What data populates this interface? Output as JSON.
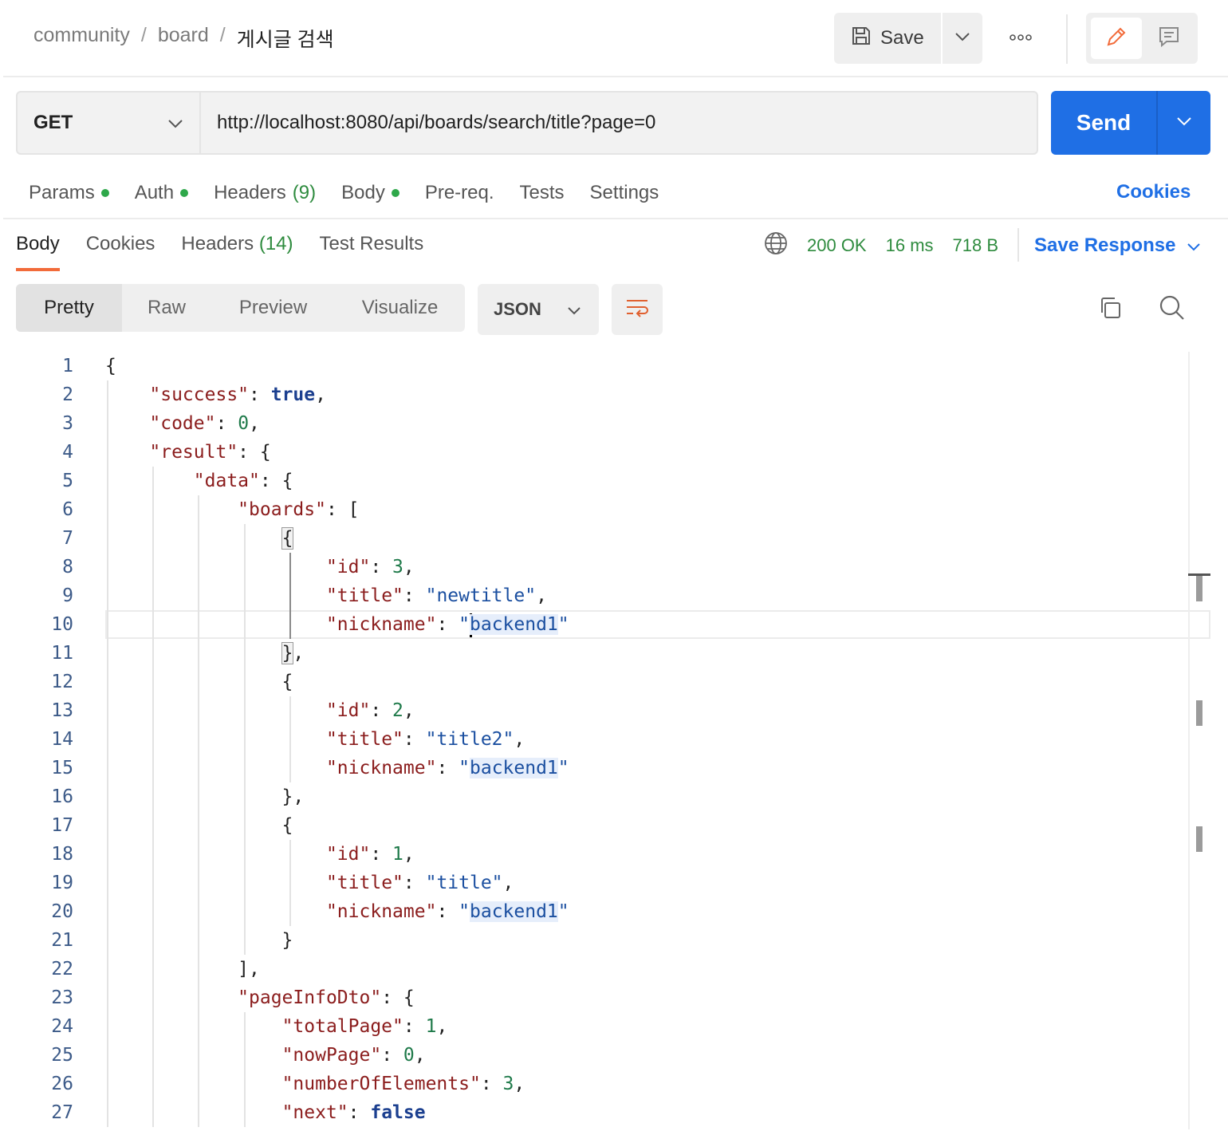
{
  "breadcrumb": {
    "items": [
      "community",
      "board"
    ],
    "current": "게시글 검색",
    "separator": "/"
  },
  "header": {
    "save_label": "Save"
  },
  "request": {
    "method": "GET",
    "url": "http://localhost:8080/api/boards/search/title?page=0",
    "send_label": "Send"
  },
  "request_tabs": [
    {
      "label": "Params",
      "dot": true
    },
    {
      "label": "Auth",
      "dot": true
    },
    {
      "label": "Headers",
      "count": "(9)"
    },
    {
      "label": "Body",
      "dot": true
    },
    {
      "label": "Pre-req."
    },
    {
      "label": "Tests"
    },
    {
      "label": "Settings"
    }
  ],
  "cookies_link": "Cookies",
  "response_tabs": [
    {
      "label": "Body",
      "active": true
    },
    {
      "label": "Cookies"
    },
    {
      "label": "Headers",
      "count": "(14)"
    },
    {
      "label": "Test Results"
    }
  ],
  "status": {
    "code": "200 OK",
    "time": "16 ms",
    "size": "718 B"
  },
  "save_response_label": "Save Response",
  "views": [
    "Pretty",
    "Raw",
    "Preview",
    "Visualize"
  ],
  "format": "JSON",
  "colors": {
    "accent": "#1f6fe5",
    "tab_underline": "#f26b3a",
    "status_green": "#2e8b3e"
  },
  "icons": [
    "save-icon",
    "chevron-down-icon",
    "more-icon",
    "pencil-icon",
    "comment-icon",
    "globe-icon",
    "wrap-lines-icon",
    "copy-icon",
    "search-icon"
  ],
  "code_lines": [
    "{",
    "    \"success\": true,",
    "    \"code\": 0,",
    "    \"result\": {",
    "        \"data\": {",
    "            \"boards\": [",
    "                {",
    "                    \"id\": 3,",
    "                    \"title\": \"newtitle\",",
    "                    \"nickname\": \"backend1\"",
    "                },",
    "                {",
    "                    \"id\": 2,",
    "                    \"title\": \"title2\",",
    "                    \"nickname\": \"backend1\"",
    "                },",
    "                {",
    "                    \"id\": 1,",
    "                    \"title\": \"title\",",
    "                    \"nickname\": \"backend1\"",
    "                }",
    "            ],",
    "            \"pageInfoDto\": {",
    "                \"totalPage\": 1,",
    "                \"nowPage\": 0,",
    "                \"numberOfElements\": 3,",
    "                \"next\": false"
  ]
}
